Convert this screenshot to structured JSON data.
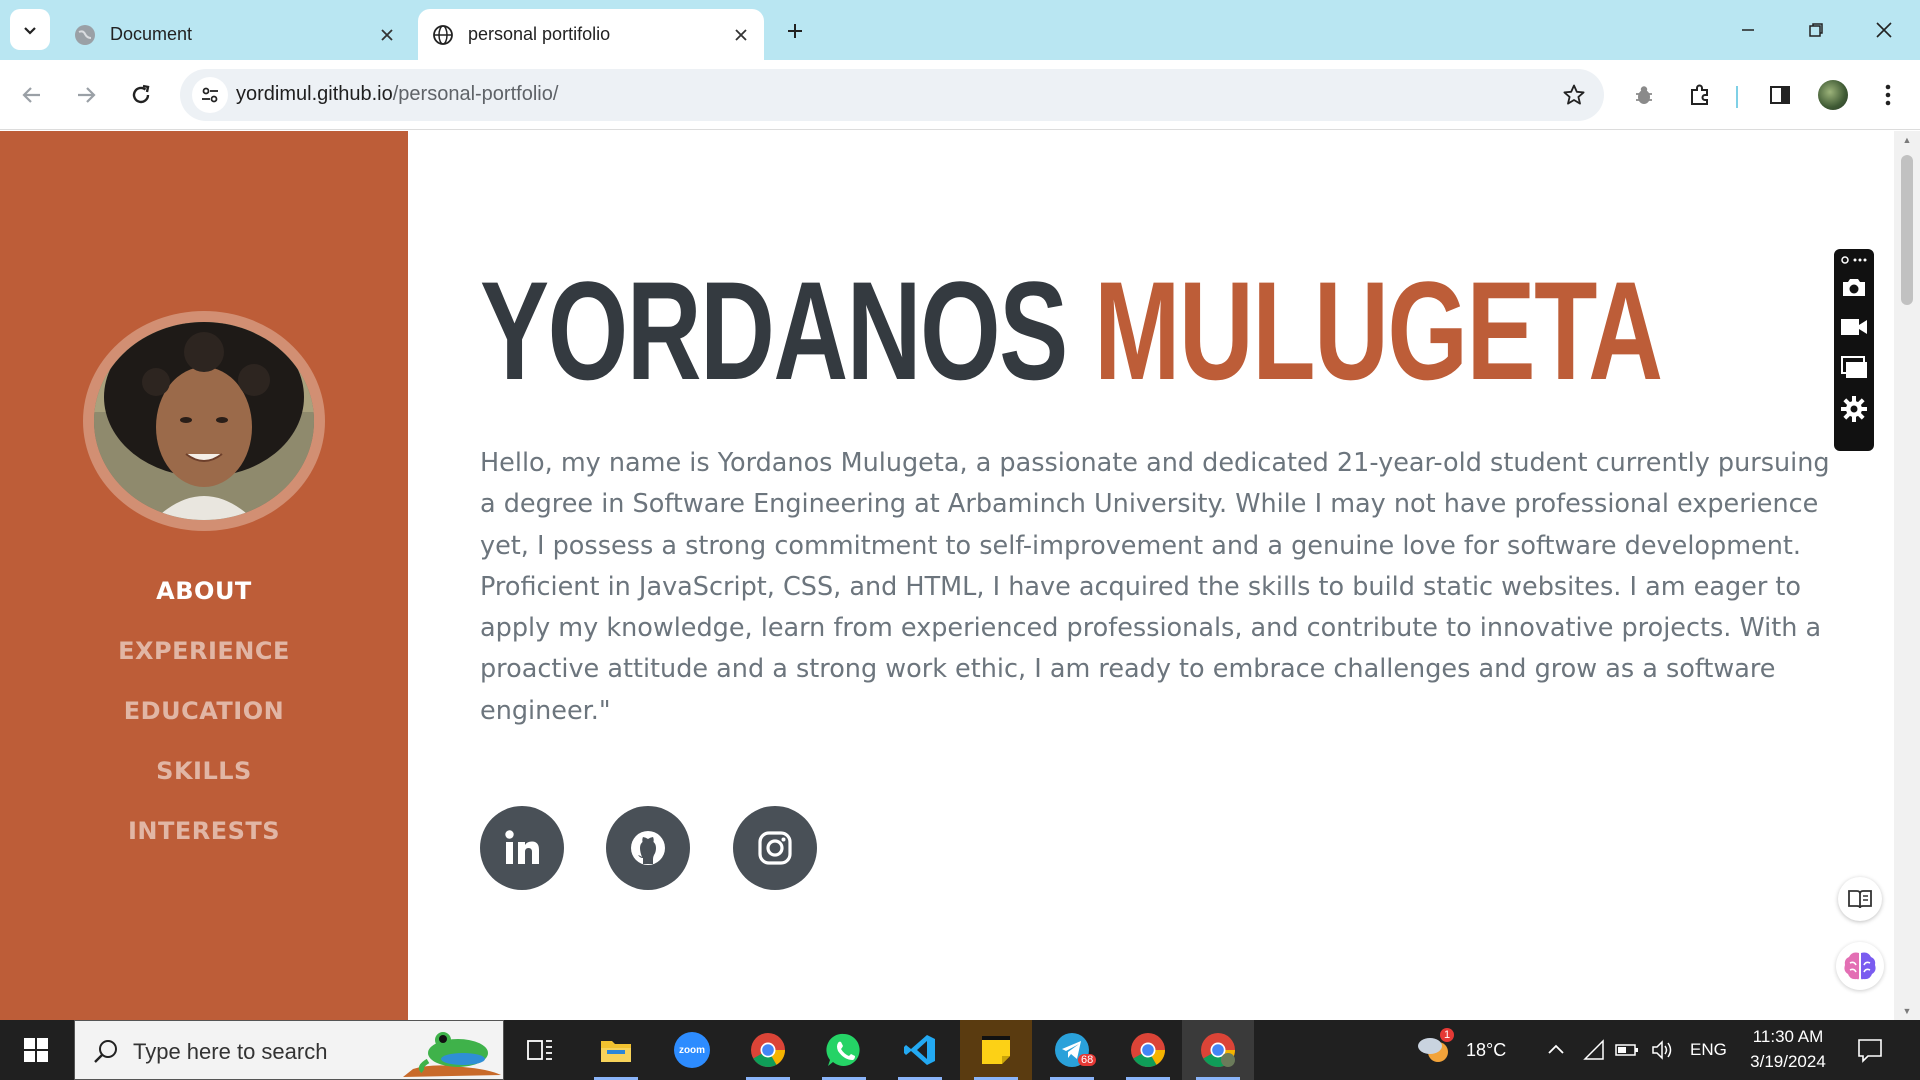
{
  "browser": {
    "tabs": [
      {
        "title": "Document",
        "active": false
      },
      {
        "title": "personal portifolio",
        "active": true
      }
    ],
    "url_domain": "yordimul.github.io",
    "url_path": "/personal-portfolio/"
  },
  "sidebar": {
    "color": "#bd5d38",
    "nav": [
      {
        "label": "ABOUT",
        "active": true
      },
      {
        "label": "EXPERIENCE",
        "active": false
      },
      {
        "label": "EDUCATION",
        "active": false
      },
      {
        "label": "SKILLS",
        "active": false
      },
      {
        "label": "INTERESTS",
        "active": false
      }
    ]
  },
  "main": {
    "first_name": "YORDANOS",
    "last_name": "MULUGETA",
    "bio": "Hello, my name is Yordanos Mulugeta, a passionate and dedicated 21-year-old student currently pursuing a degree in Software Engineering at Arbaminch University. While I may not have professional experience yet, I possess a strong commitment to self-improvement and a genuine love for software development. Proficient in JavaScript, CSS, and HTML, I have acquired the skills to build static websites. I am eager to apply my knowledge, learn from experienced professionals, and contribute to innovative projects. With a proactive attitude and a strong work ethic, I am ready to embrace challenges and grow as a software engineer.\"",
    "social": [
      "linkedin-icon",
      "github-icon",
      "instagram-icon"
    ]
  },
  "taskbar": {
    "search_placeholder": "Type here to search",
    "apps": [
      "task-view-icon",
      "file-explorer-icon",
      "zoom-icon",
      "chrome-icon",
      "whatsapp-icon",
      "vscode-icon",
      "sticky-notes-icon",
      "telegram-icon",
      "chrome-icon",
      "chrome-profile-icon"
    ],
    "zoom_label": "zoom",
    "telegram_badge": "68",
    "weather_badge": "1",
    "temperature": "18°C",
    "language": "ENG",
    "time": "11:30 AM",
    "date": "3/19/2024"
  }
}
